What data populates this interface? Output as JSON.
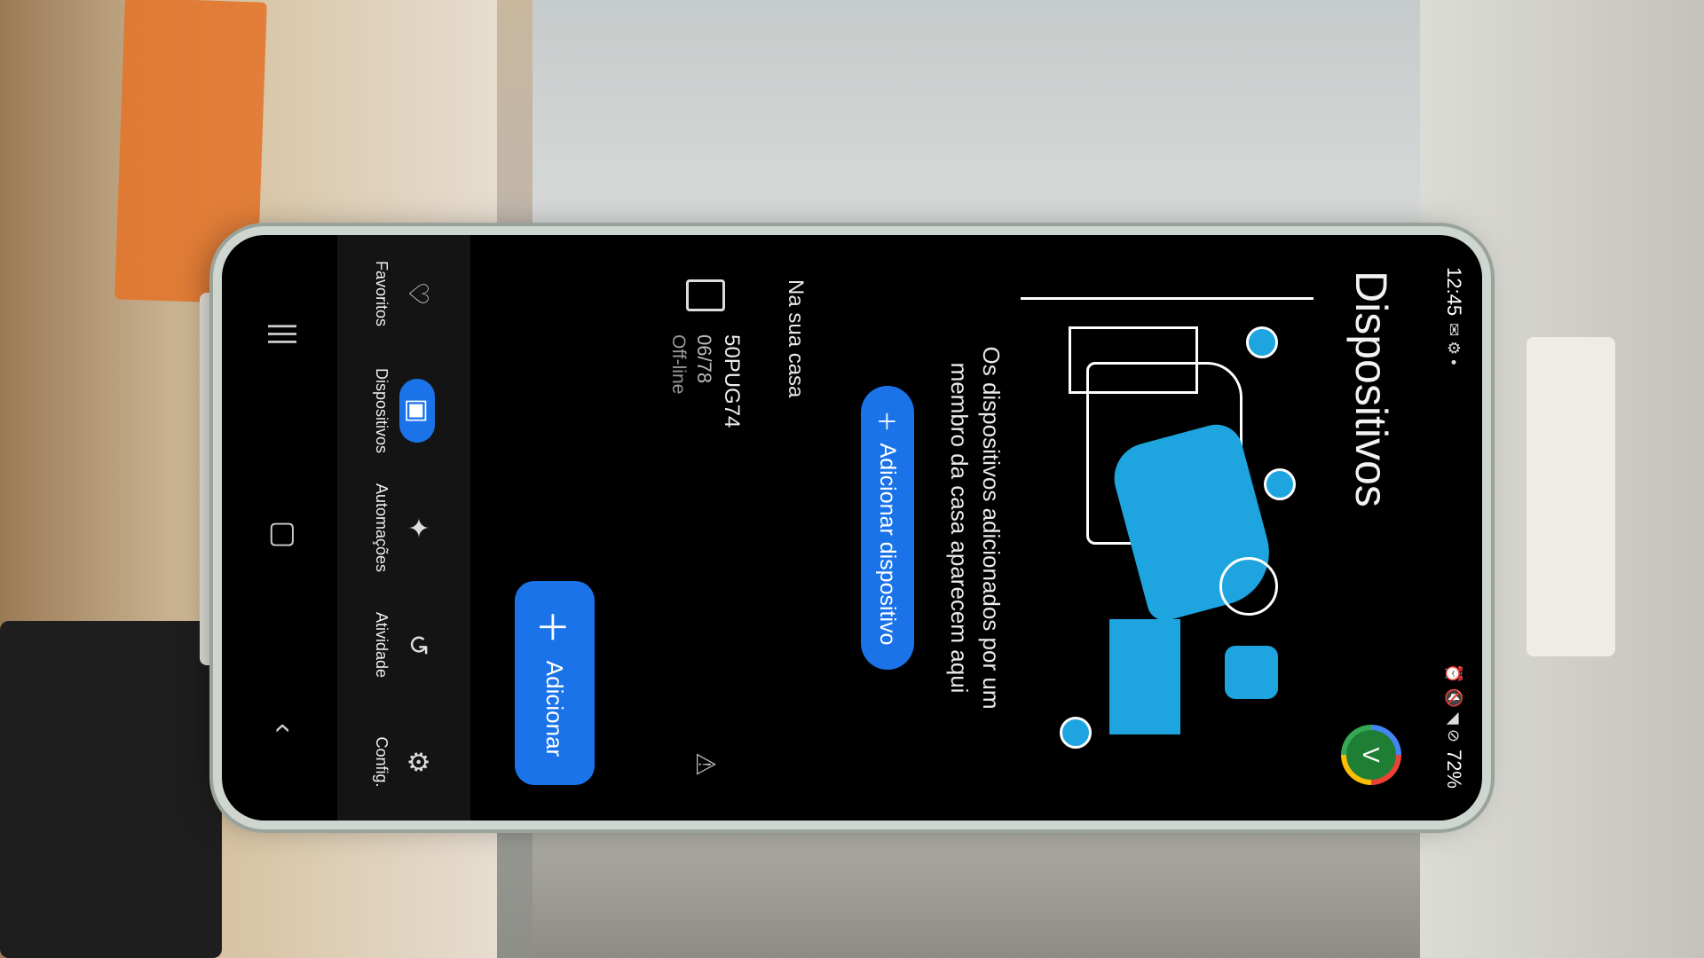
{
  "status_bar": {
    "time": "12:45",
    "battery": "72%"
  },
  "header": {
    "title": "Dispositivos",
    "avatar_letter": "V"
  },
  "empty_state": {
    "message": "Os dispositivos adicionados por um membro da casa aparecem aqui",
    "add_device_label": "Adicionar dispositivo"
  },
  "section": {
    "label": "Na sua casa"
  },
  "devices": [
    {
      "name": "50PUG74",
      "model": "06/78",
      "status": "Off-line",
      "icon": "tv-icon"
    }
  ],
  "fab": {
    "label": "Adicionar"
  },
  "bottom_nav": [
    {
      "label": "Favoritos",
      "icon": "heart-icon",
      "active": false
    },
    {
      "label": "Dispositivos",
      "icon": "devices-icon",
      "active": true
    },
    {
      "label": "Automações",
      "icon": "sparkle-icon",
      "active": false
    },
    {
      "label": "Atividade",
      "icon": "history-icon",
      "active": false
    },
    {
      "label": "Config.",
      "icon": "gear-icon",
      "active": false
    }
  ],
  "colors": {
    "accent": "#1a73e8",
    "illustration": "#1ea5e0"
  }
}
